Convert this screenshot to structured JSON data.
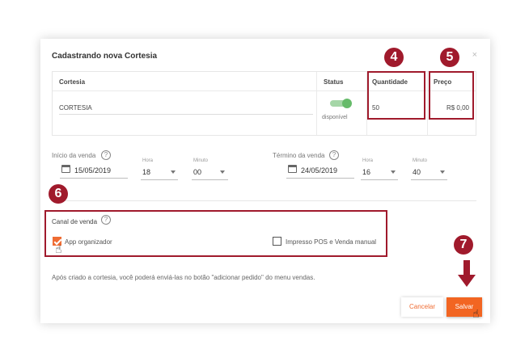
{
  "modal": {
    "title": "Cadastrando nova Cortesia",
    "close": "×"
  },
  "table": {
    "headers": {
      "cortesia": "Cortesia",
      "status": "Status",
      "quantidade": "Quantidade",
      "preco": "Preço"
    },
    "row": {
      "cortesia": "CORTESIA",
      "status": "disponível",
      "quantidade": "50",
      "preco": "R$ 0,00"
    }
  },
  "inicio": {
    "label": "Início da venda",
    "date": "15/05/2019",
    "hora_label": "Hora",
    "hora": "18",
    "minuto_label": "Minuto",
    "minuto": "00"
  },
  "termino": {
    "label": "Término da venda",
    "date": "24/05/2019",
    "hora_label": "Hora",
    "hora": "16",
    "minuto_label": "Minuto",
    "minuto": "40"
  },
  "canal": {
    "label": "Canal de venda",
    "option1": "App organizador",
    "option1_checked": true,
    "option2": "Impresso POS e Venda manual",
    "option2_checked": false
  },
  "info_text": "Após criado a cortesia, você poderá enviá-las no botão \"adicionar pedido\" do menu vendas.",
  "buttons": {
    "cancel": "Cancelar",
    "save": "Salvar"
  },
  "badges": {
    "b4": "4",
    "b5": "5",
    "b6": "6",
    "b7": "7"
  },
  "icons": {
    "help": "?"
  },
  "colors": {
    "accent": "#f26522",
    "highlight": "#a01a2c",
    "toggle_on": "#66bb6a"
  }
}
